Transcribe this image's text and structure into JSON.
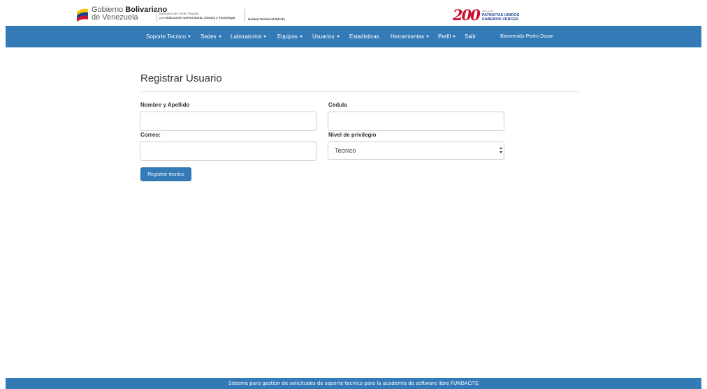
{
  "header": {
    "gov_name_line1_light": "Gobierno",
    "gov_name_line1_bold": "Bolivariano",
    "gov_name_line2": "de Venezuela",
    "ministry_line1": "Ministerio del Poder Popular",
    "ministry_line2_prefix": "para",
    "ministry_line2_bold": "Educación Universitaria, Ciencia y Tecnología",
    "territorial_unit": "Unidad Territorial Mérida",
    "anniversary_number": "200",
    "anniversary_small": "1810-2010",
    "anniversary_slogan_line1": "PATRIOTAS UNIDOS",
    "anniversary_slogan_line2": "SABEMOS VENCER"
  },
  "navbar": {
    "items": [
      {
        "label": "Soporte Tecnico",
        "dropdown": true
      },
      {
        "label": "Sedes",
        "dropdown": true
      },
      {
        "label": "Laboratorios",
        "dropdown": true
      },
      {
        "label": "Equipos",
        "dropdown": true
      },
      {
        "label": "Usuarios",
        "dropdown": true
      },
      {
        "label": "Estadisticas",
        "dropdown": false
      },
      {
        "label": "Herramientas",
        "dropdown": true
      },
      {
        "label": "Perfil",
        "dropdown": true
      },
      {
        "label": "Salir",
        "dropdown": false
      }
    ],
    "welcome": "Bienvenido Pedro Duran",
    "color": "#337ab7"
  },
  "form": {
    "title": "Registrar Usuario",
    "name_label": "Nombre y Apellido",
    "name_value": "",
    "cedula_label": "Cedula",
    "cedula_value": "",
    "email_label": "Correo:",
    "email_value": "",
    "privilege_label": "Nivel de privilegio",
    "privilege_selected": "Tecnico",
    "submit_label": "Registrar tecnico"
  },
  "footer": {
    "text": "Sistema para gestion de solicitudes de soporte tecnico para la academia de software libre FUNDACITE"
  }
}
